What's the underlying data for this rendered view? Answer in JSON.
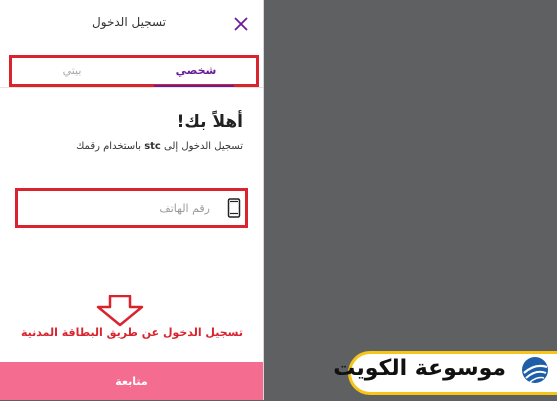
{
  "header": {
    "title": "تسجيل الدخول",
    "close_icon": "close-icon"
  },
  "tabs": [
    {
      "label": "شخصي",
      "selected": true
    },
    {
      "label": "بيتي",
      "selected": false
    }
  ],
  "main": {
    "welcome": "أهلاً بك!",
    "subtitle_prefix": "تسجيل الدخول إلى ",
    "subtitle_brand": "stc",
    "subtitle_suffix": " باستخدام رقمك",
    "phone_placeholder": "رقم الهاتف",
    "phone_icon": "mobile-phone-icon",
    "civil_id_link": "تسجيل الدخول عن طريق البطاقة المدنية",
    "continue_label": "متابعة"
  },
  "watermark": {
    "text": "موسوعة الكويت",
    "icon": "globe-logo-icon"
  },
  "colors": {
    "accent_purple": "#6a1b9a",
    "annotation_red": "#d9232e",
    "button_pink": "#f46d91",
    "backdrop": "#5f6062",
    "watermark_yellow": "#f5c518"
  }
}
